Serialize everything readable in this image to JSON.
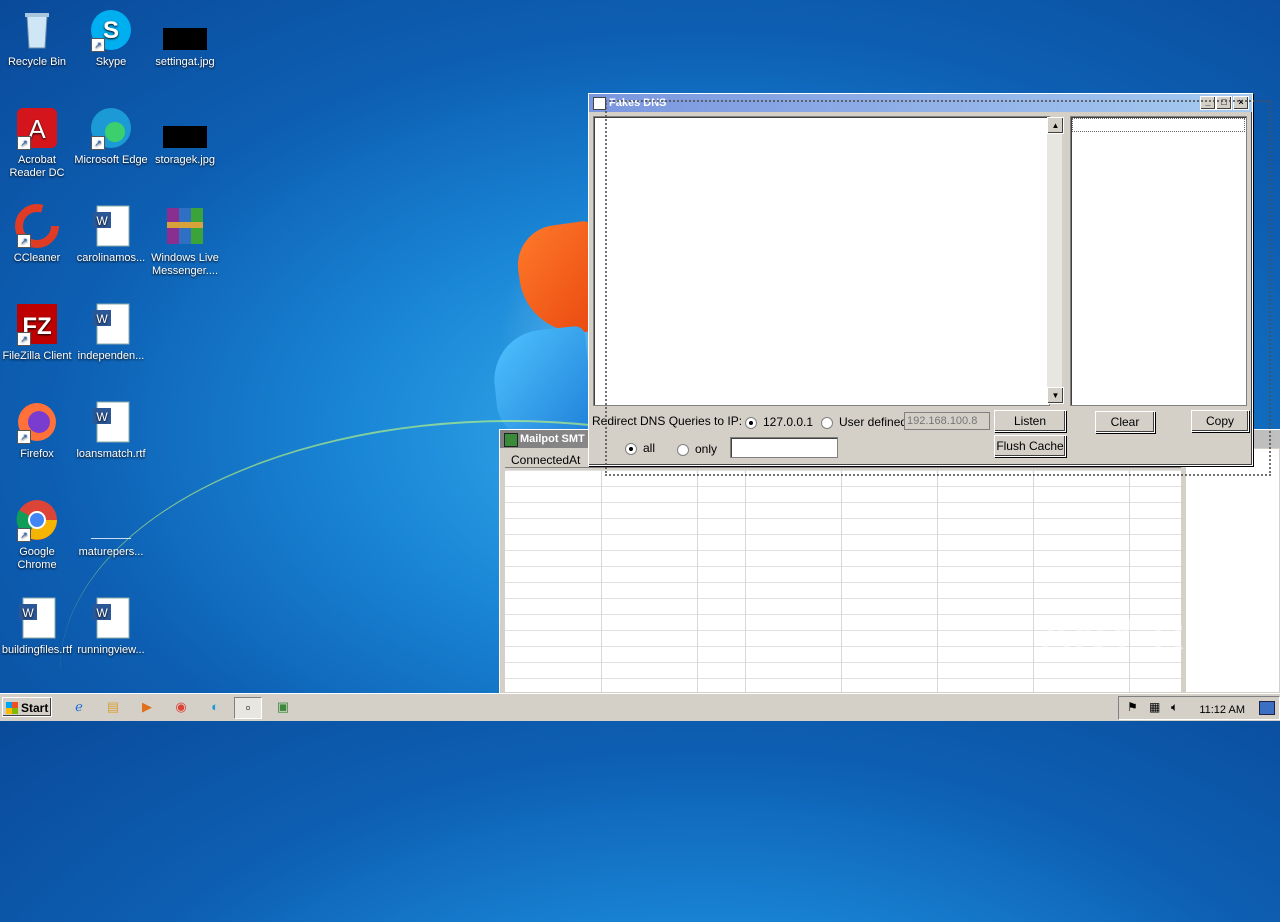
{
  "desktop": {
    "icons": [
      {
        "label": "Recycle Bin"
      },
      {
        "label": "Skype"
      },
      {
        "label": "settingat.jpg"
      },
      {
        "label": "Acrobat Reader DC"
      },
      {
        "label": "Microsoft Edge"
      },
      {
        "label": "storagek.jpg"
      },
      {
        "label": "CCleaner"
      },
      {
        "label": "carolinamos..."
      },
      {
        "label": "Windows Live Messenger...."
      },
      {
        "label": "FileZilla Client"
      },
      {
        "label": "independen..."
      },
      {
        "label": "Firefox"
      },
      {
        "label": "loansmatch.rtf"
      },
      {
        "label": "Google Chrome"
      },
      {
        "label": "maturepers..."
      },
      {
        "label": "buildingfiles.rtf"
      },
      {
        "label": "runningview..."
      }
    ]
  },
  "fakedns": {
    "title": "Fakes DNS",
    "redirect_label": "Redirect DNS Queries to IP:",
    "radio_local": "127.0.0.1",
    "radio_user": "User defined",
    "user_ip_placeholder": "192.168.100.8",
    "radio_all": "all",
    "radio_only": "only",
    "listen_label": "Listen",
    "flush_label": "Flush Cache",
    "clear_label": "Clear",
    "copy_label": "Copy"
  },
  "mailpot": {
    "title": "Mailpot SMT",
    "columns": [
      "ConnectedAt"
    ]
  },
  "taskbar": {
    "start_label": "Start",
    "clock": "11:12 AM"
  },
  "watermark": "ANY RUN"
}
